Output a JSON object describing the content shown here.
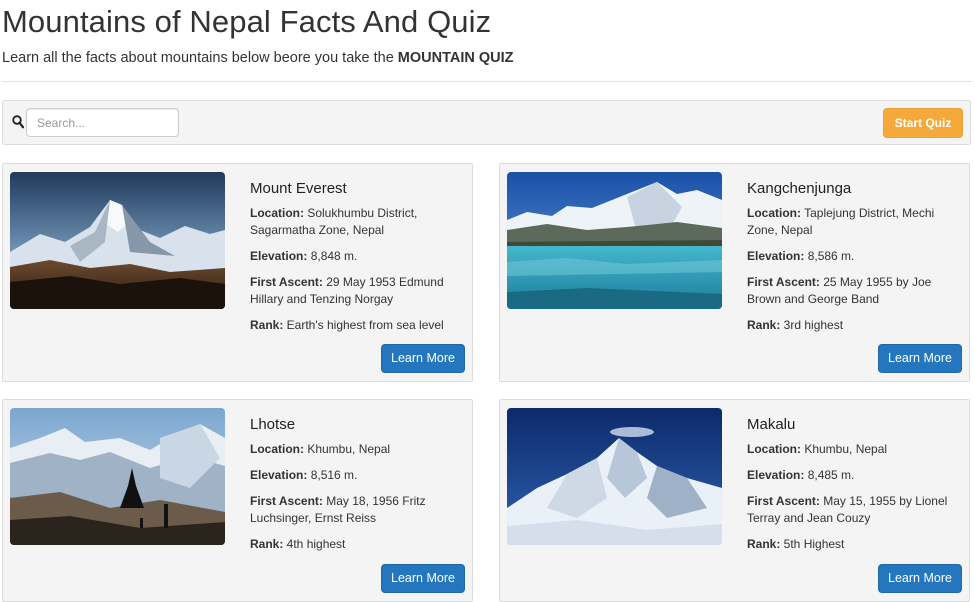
{
  "header": {
    "title": "Mountains of Nepal Facts And Quiz",
    "subtitle_text": "Learn all the facts about mountains below beore you take the ",
    "subtitle_bold": "MOUNTAIN QUIZ"
  },
  "toolbar": {
    "search_placeholder": "Search...",
    "search_icon": "magnifier-icon",
    "start_quiz_label": "Start Quiz"
  },
  "colors": {
    "start_quiz": "#f5a93b",
    "learn_more": "#2476be",
    "card_bg": "#f4f4f4"
  },
  "mountains": [
    {
      "name": "Mount Everest",
      "location_label": "Location:",
      "location": " Solukhumbu District, Sagarmatha Zone, Nepal",
      "elevation_label": "Elevation:",
      "elevation": " 8,848 m.",
      "ascent_label": "First Ascent:",
      "ascent": " 29 May 1953 Edmund Hillary and Tenzing Norgay",
      "rank_label": "Rank:",
      "rank": " Earth's highest from sea level",
      "button": "Learn More"
    },
    {
      "name": "Kangchenjunga",
      "location_label": "Location:",
      "location": " Taplejung District, Mechi Zone, Nepal",
      "elevation_label": "Elevation:",
      "elevation": " 8,586 m.",
      "ascent_label": "First Ascent:",
      "ascent": " 25 May 1955 by Joe Brown and George Band",
      "rank_label": "Rank:",
      "rank": " 3rd highest",
      "button": "Learn More"
    },
    {
      "name": "Lhotse",
      "location_label": "Location:",
      "location": " Khumbu, Nepal",
      "elevation_label": "Elevation:",
      "elevation": " 8,516 m.",
      "ascent_label": "First Ascent:",
      "ascent": " May 18, 1956 Fritz Luchsinger, Ernst Reiss",
      "rank_label": "Rank:",
      "rank": " 4th highest",
      "button": "Learn More"
    },
    {
      "name": "Makalu",
      "location_label": "Location:",
      "location": " Khumbu, Nepal",
      "elevation_label": "Elevation:",
      "elevation": " 8,485 m.",
      "ascent_label": "First Ascent:",
      "ascent": " May 15, 1955 by Lionel Terray and Jean Couzy",
      "rank_label": "Rank:",
      "rank": " 5th Highest",
      "button": "Learn More"
    }
  ]
}
